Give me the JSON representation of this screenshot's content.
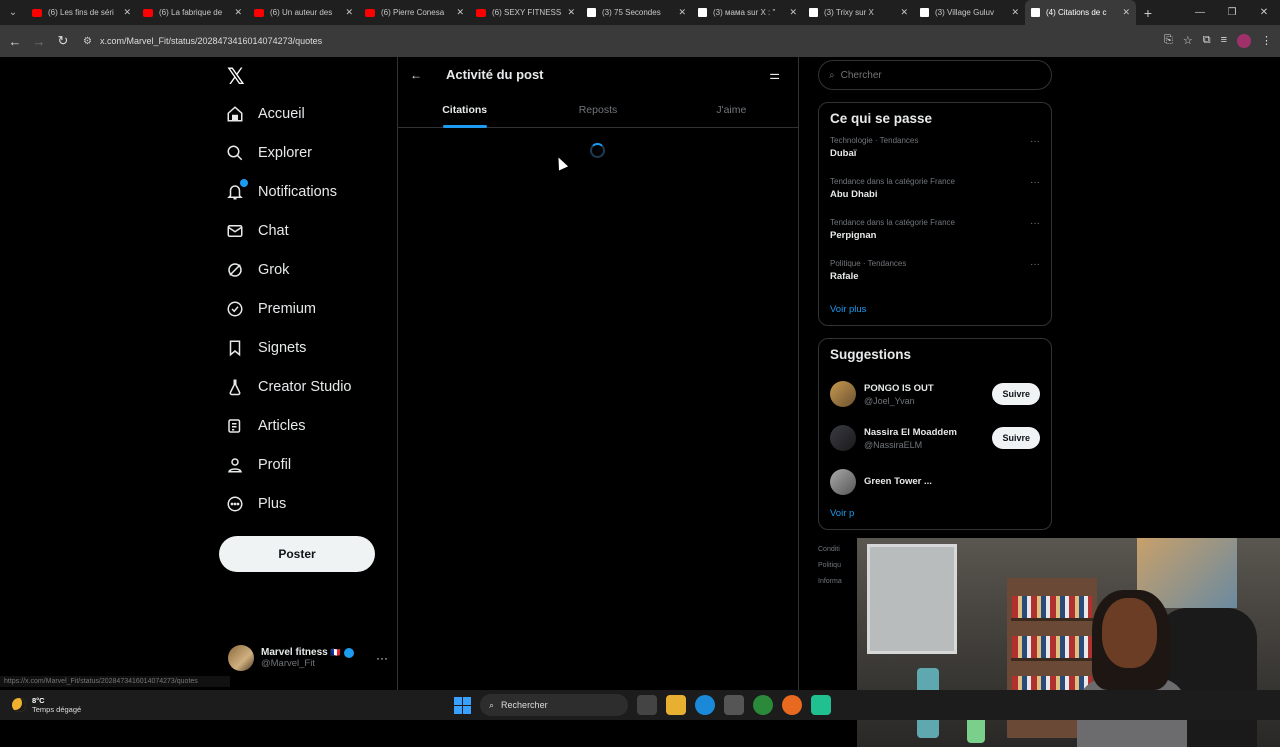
{
  "browser": {
    "tabs": [
      {
        "label": "(6) Les fins de séri",
        "icon": "youtube-icon",
        "active": false
      },
      {
        "label": "(6) La fabrique de",
        "icon": "youtube-icon",
        "active": false
      },
      {
        "label": "(6) Un auteur des",
        "icon": "youtube-icon",
        "active": false
      },
      {
        "label": "(6) Pierre Conesa",
        "icon": "youtube-icon",
        "active": false
      },
      {
        "label": "(6) SEXY FITNESS",
        "icon": "youtube-icon",
        "active": false
      },
      {
        "label": "(3) 75 Secondes",
        "icon": "x-icon",
        "active": false
      },
      {
        "label": "(3) мама sur X : \"",
        "icon": "x-icon",
        "active": false
      },
      {
        "label": "(3) Trixy sur X",
        "icon": "x-icon",
        "active": false
      },
      {
        "label": "(3) Village Guluv",
        "icon": "x-icon",
        "active": false
      },
      {
        "label": "(4) Citations de c",
        "icon": "x-icon",
        "active": true
      }
    ],
    "url": "x.com/Marvel_Fit/status/2028473416014074273/quotes",
    "status_url": "https://x.com/Marvel_Fit/status/2028473416014074273/quotes"
  },
  "nav": {
    "items": [
      {
        "label": "Accueil",
        "icon": "home-icon"
      },
      {
        "label": "Explorer",
        "icon": "search-icon"
      },
      {
        "label": "Notifications",
        "icon": "bell-icon"
      },
      {
        "label": "Chat",
        "icon": "mail-icon"
      },
      {
        "label": "Grok",
        "icon": "grok-icon"
      },
      {
        "label": "Premium",
        "icon": "verified-badge-icon"
      },
      {
        "label": "Signets",
        "icon": "bookmark-icon"
      },
      {
        "label": "Creator Studio",
        "icon": "flask-icon"
      },
      {
        "label": "Articles",
        "icon": "article-icon"
      },
      {
        "label": "Profil",
        "icon": "person-icon"
      },
      {
        "label": "Plus",
        "icon": "more-circle-icon"
      }
    ],
    "post_label": "Poster",
    "account": {
      "name": "Marvel fitness",
      "handle": "@Marvel_Fit",
      "flag": "🇫🇷"
    }
  },
  "main": {
    "title": "Activité du post",
    "tabs": [
      {
        "label": "Citations",
        "active": true
      },
      {
        "label": "Reposts",
        "active": false
      },
      {
        "label": "J'aime",
        "active": false
      }
    ]
  },
  "sidebar": {
    "search_placeholder": "Chercher",
    "trends_title": "Ce qui se passe",
    "trends": [
      {
        "meta": "Technologie · Tendances",
        "name": "Dubaï"
      },
      {
        "meta": "Tendance dans la catégorie France",
        "name": "Abu Dhabi"
      },
      {
        "meta": "Tendance dans la catégorie France",
        "name": "Perpignan"
      },
      {
        "meta": "Politique · Tendances",
        "name": "Rafale"
      }
    ],
    "show_more": "Voir plus",
    "suggestions_title": "Suggestions",
    "suggestions": [
      {
        "name": "PONGO IS OUT",
        "handle": "@Joel_Yvan",
        "button": "Suivre"
      },
      {
        "name": "Nassira El Moaddem",
        "handle": "@NassiraELM",
        "button": "Suivre"
      },
      {
        "name": "Green Tower ...",
        "handle": "",
        "button": ""
      }
    ],
    "show_more_2": "Voir p",
    "footer": [
      "Conditi",
      "Politiqu",
      "Informa"
    ]
  },
  "taskbar": {
    "temp": "8°C",
    "weather": "Temps dégagé",
    "search": "Rechercher"
  },
  "colors": {
    "accent": "#1d9bf0",
    "background": "#000000",
    "border": "#2f3336"
  }
}
